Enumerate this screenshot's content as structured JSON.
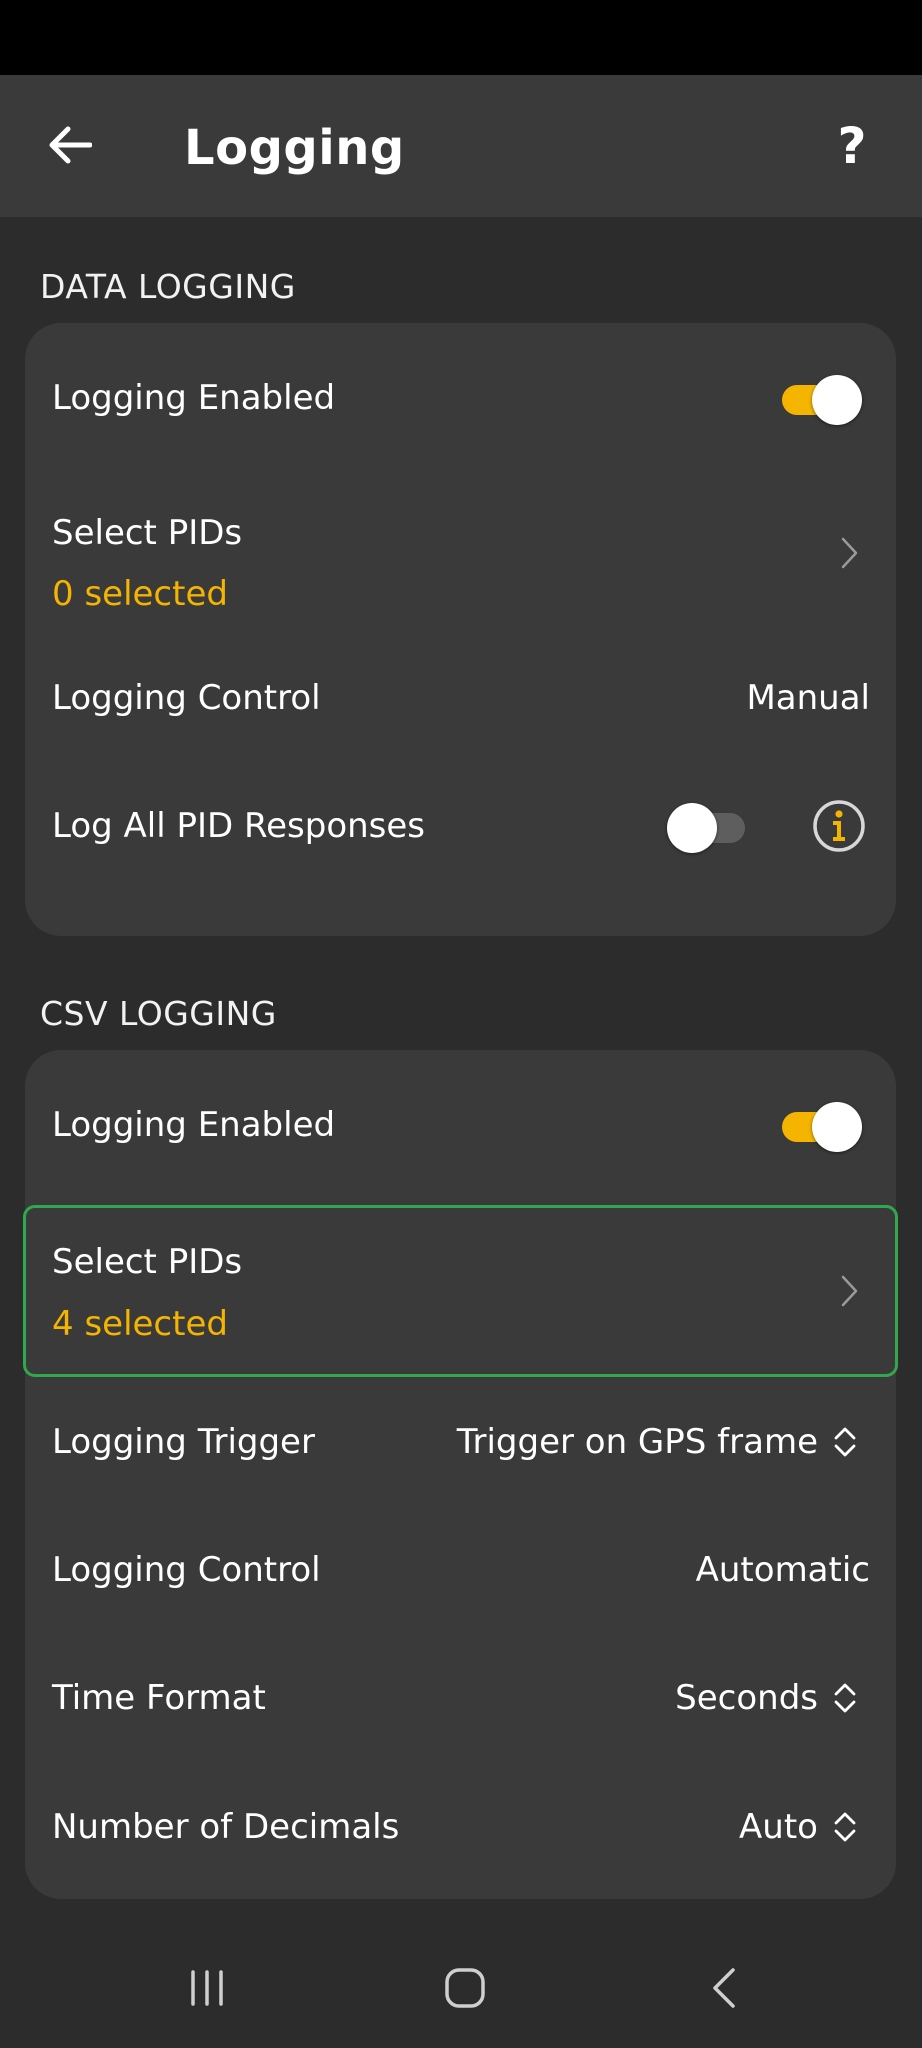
{
  "app_bar": {
    "title": "Logging",
    "help_label": "?"
  },
  "data_logging": {
    "header": "DATA LOGGING",
    "logging_enabled": {
      "label": "Logging Enabled",
      "on": true
    },
    "select_pids": {
      "label": "Select PIDs",
      "sub": "0 selected"
    },
    "logging_control": {
      "label": "Logging Control",
      "value": "Manual"
    },
    "log_all_pid": {
      "label": "Log All PID Responses",
      "on": false
    }
  },
  "csv_logging": {
    "header": "CSV LOGGING",
    "logging_enabled": {
      "label": "Logging Enabled",
      "on": true
    },
    "select_pids": {
      "label": "Select PIDs",
      "sub": "4 selected"
    },
    "logging_trigger": {
      "label": "Logging Trigger",
      "value": "Trigger on GPS frame"
    },
    "logging_control": {
      "label": "Logging Control",
      "value": "Automatic"
    },
    "time_format": {
      "label": "Time Format",
      "value": "Seconds"
    },
    "decimals": {
      "label": "Number of Decimals",
      "value": "Auto"
    }
  },
  "colors": {
    "accent": "#f4b400",
    "focus": "#2fa84f",
    "background": "#2c2c2c",
    "card": "#3a3a3a"
  },
  "icons": {
    "back": "arrow-left-icon",
    "chevron": "chevron-right-icon",
    "select": "up-down-chevron-icon",
    "info": "info-circle-icon"
  }
}
